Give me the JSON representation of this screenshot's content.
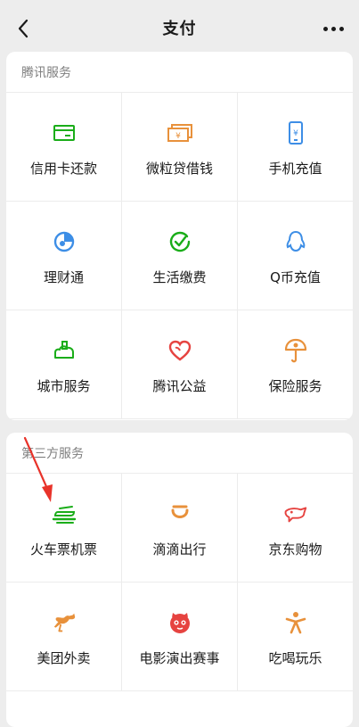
{
  "nav": {
    "title": "支付"
  },
  "sections": [
    {
      "title": "腾讯服务",
      "items": [
        {
          "label": "信用卡还款",
          "icon": "credit-card-icon",
          "color": "#1aad19"
        },
        {
          "label": "微粒贷借钱",
          "icon": "cash-icon",
          "color": "#e8913b"
        },
        {
          "label": "手机充值",
          "icon": "phone-icon",
          "color": "#3d8ee6"
        },
        {
          "label": "理财通",
          "icon": "wealth-icon",
          "color": "#3d8ee6"
        },
        {
          "label": "生活缴费",
          "icon": "bill-check-icon",
          "color": "#1aad19"
        },
        {
          "label": "Q币充值",
          "icon": "qq-penguin-icon",
          "color": "#3d8ee6"
        },
        {
          "label": "城市服务",
          "icon": "city-icon",
          "color": "#1aad19"
        },
        {
          "label": "腾讯公益",
          "icon": "charity-heart-icon",
          "color": "#e64340"
        },
        {
          "label": "保险服务",
          "icon": "umbrella-icon",
          "color": "#e8913b"
        }
      ]
    },
    {
      "title": "第三方服务",
      "items": [
        {
          "label": "火车票机票",
          "icon": "train-icon",
          "color": "#1aad19"
        },
        {
          "label": "滴滴出行",
          "icon": "didi-icon",
          "color": "#e8913b"
        },
        {
          "label": "京东购物",
          "icon": "jd-dog-icon",
          "color": "#e64340"
        },
        {
          "label": "美团外卖",
          "icon": "kangaroo-icon",
          "color": "#e8913b"
        },
        {
          "label": "电影演出赛事",
          "icon": "movie-cat-icon",
          "color": "#e64340"
        },
        {
          "label": "吃喝玩乐",
          "icon": "person-fun-icon",
          "color": "#e8913b"
        }
      ]
    }
  ],
  "colors": {
    "green": "#1aad19",
    "orange": "#e8913b",
    "blue": "#3d8ee6",
    "red": "#e64340",
    "annotation_arrow": "#e8332a"
  }
}
